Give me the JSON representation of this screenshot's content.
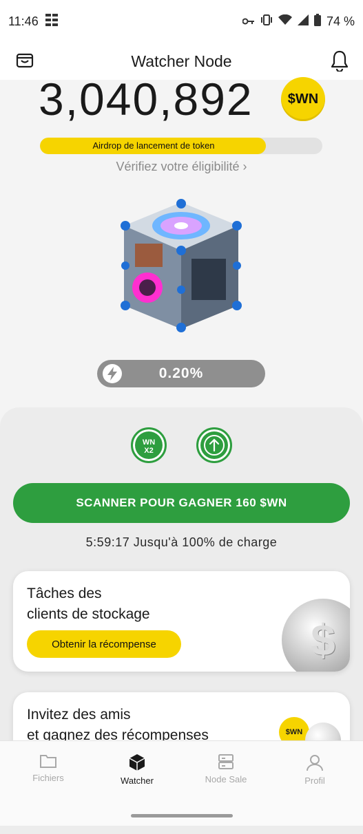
{
  "status": {
    "time": "11:46",
    "battery": "74 %"
  },
  "header": {
    "title": "Watcher Node"
  },
  "balance": {
    "value": "3,040,892",
    "coin_label": "$WN"
  },
  "airdrop": {
    "label": "Airdrop de lancement de token",
    "progress_fraction": 0.8
  },
  "eligibility": {
    "link_text": "Vérifiez votre éligibilité ›"
  },
  "rate": {
    "value": "0.20%"
  },
  "boosts": {
    "multiplier_label_1": "WN",
    "multiplier_label_2": "X2"
  },
  "scan": {
    "button_label": "SCANNER POUR GAGNER 160 $WN",
    "charge_text": "5:59:17 Jusqu'à 100% de charge"
  },
  "card_storage": {
    "title_line1": "Tâches des",
    "title_line2": "clients de stockage",
    "button_label": "Obtenir la récompense"
  },
  "card_invite": {
    "title_line1": "Invitez des amis",
    "title_line2": "et gagnez des récompenses",
    "coin_label": "$WN"
  },
  "tabs": [
    {
      "label": "Fichiers"
    },
    {
      "label": "Watcher"
    },
    {
      "label": "Node Sale"
    },
    {
      "label": "Profil"
    }
  ],
  "colors": {
    "accent_green": "#2e9e3f",
    "accent_yellow": "#f6d400",
    "rate_gray": "#8f8f8f"
  }
}
